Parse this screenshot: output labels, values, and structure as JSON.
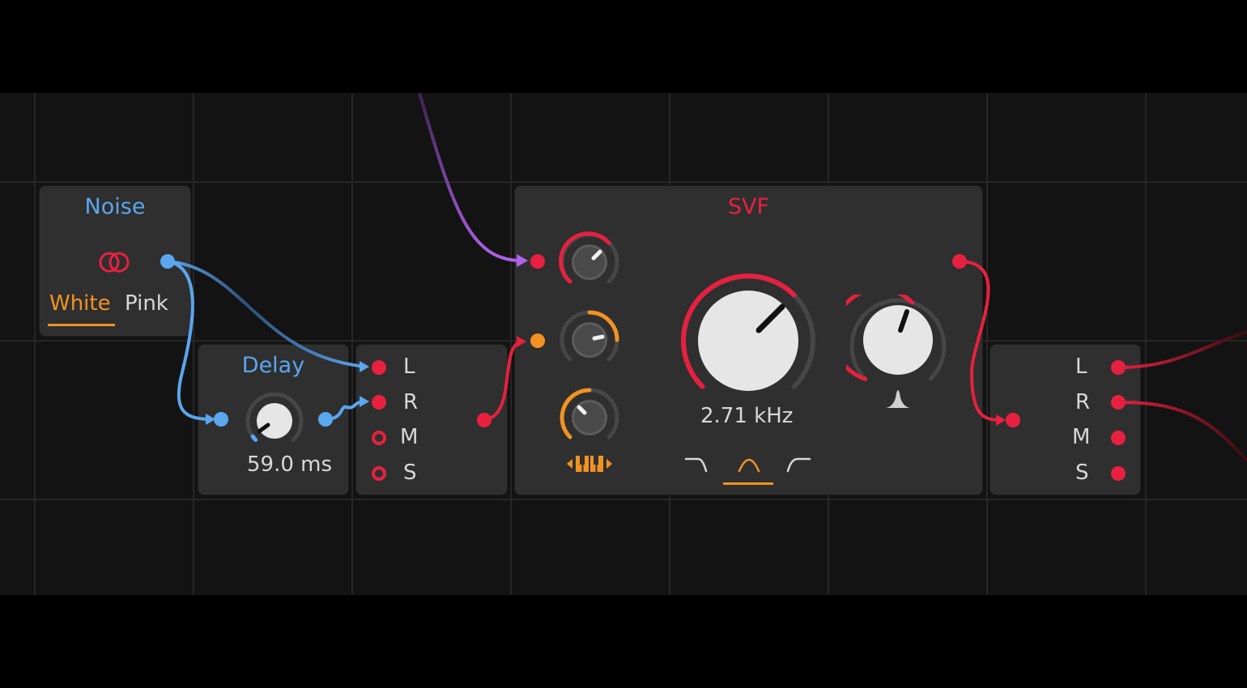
{
  "colors": {
    "red": "#e8203f",
    "blue": "#5aa7ef",
    "orange": "#f29222",
    "purple": "#b062e8"
  },
  "noise": {
    "title": "Noise",
    "icon": "stereo-rings-icon",
    "modes": [
      "White",
      "Pink"
    ],
    "selected_mode": "White"
  },
  "delay": {
    "title": "Delay",
    "value": "59.0 ms",
    "knob_level": 0.05
  },
  "split": {
    "labels": [
      "L",
      "R",
      "M",
      "S"
    ]
  },
  "svf": {
    "title": "SVF",
    "frequency": "2.71 kHz",
    "freq_knob_level": 0.65,
    "mod_knob_1_level": 0.7,
    "mod_knob_2_level": 0.55,
    "mod_knob_3_level": 0.35,
    "resonance_knob_level": 0.57,
    "filter_modes": [
      "lowpass",
      "bandpass",
      "highpass"
    ],
    "selected_filter": "bandpass",
    "keytrack_icon": "keyboard-icon",
    "resonance_icon": "peak-icon"
  },
  "output": {
    "labels": [
      "L",
      "R",
      "M",
      "S"
    ]
  }
}
